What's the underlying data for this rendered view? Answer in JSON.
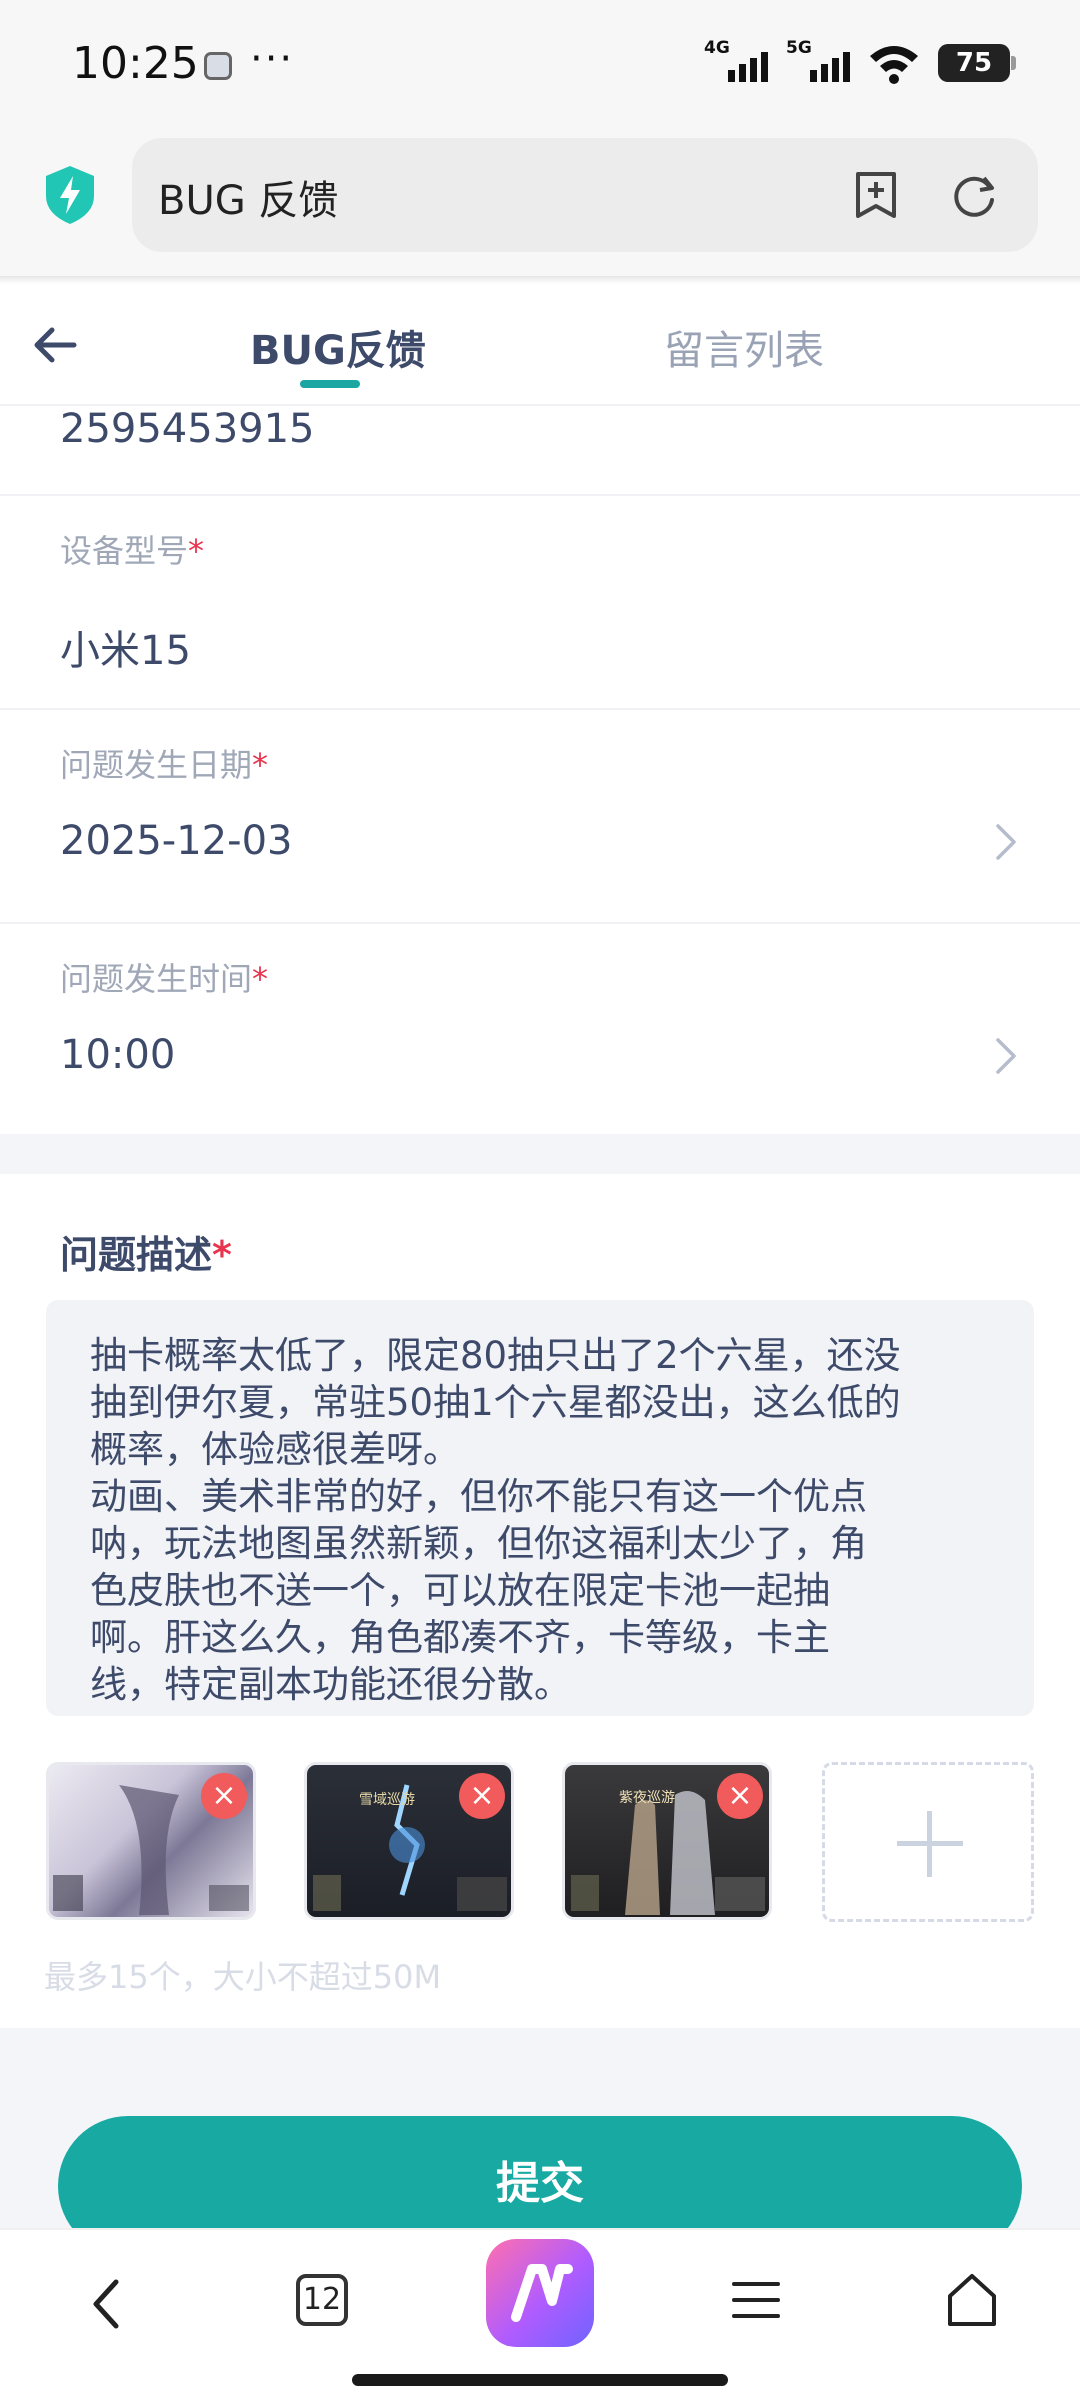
{
  "status_bar": {
    "time": "10:25",
    "dots": "···",
    "network_4g": "4G",
    "network_5g": "5G",
    "battery": "75"
  },
  "browser": {
    "url_title": "BUG 反馈"
  },
  "header": {
    "tab_feedback": "BUG反馈",
    "tab_messages": "留言列表"
  },
  "form": {
    "contact_value": "2595453915",
    "device_label": "设备型号",
    "device_value": "小米15",
    "date_label": "问题发生日期",
    "date_value": "2025-12-03",
    "time_label": "问题发生时间",
    "time_value": "10:00",
    "required_mark": "*"
  },
  "description": {
    "title": "问题描述",
    "text": "抽卡概率太低了，限定80抽只出了2个六星，还没\n抽到伊尔夏，常驻50抽1个六星都没出，这么低的\n概率，体验感很差呀。\n动画、美术非常的好，但你不能只有这一个优点\n呐，玩法地图虽然新颖，但你这福利太少了，角\n色皮肤也不送一个，可以放在限定卡池一起抽\n啊。肝这么久，角色都凑不齐，卡等级，卡主\n线，特定副本功能还很分散。"
  },
  "attachments": {
    "thumb_texts": [
      "",
      "雪域巡游",
      "紫夜巡游"
    ],
    "remove_glyph": "×",
    "hint": "最多15个，大小不超过50M"
  },
  "submit_label": "提交",
  "bottom_nav": {
    "tabs_count": "12"
  },
  "colors": {
    "accent": "#1aa7a1",
    "required": "#e8344e",
    "remove": "#f25b5b"
  }
}
